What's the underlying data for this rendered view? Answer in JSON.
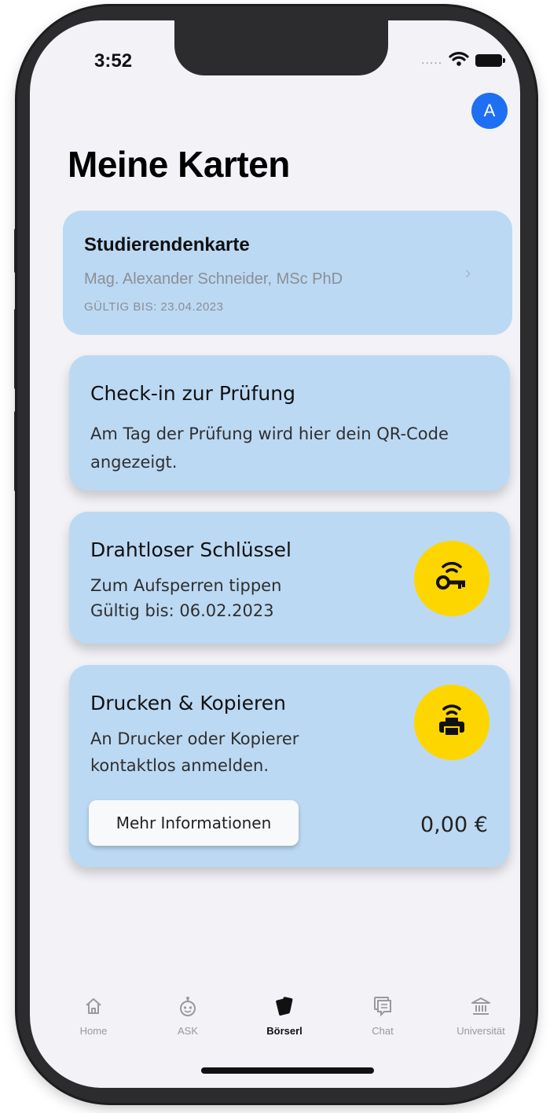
{
  "status_bar": {
    "time": "3:52",
    "signal_dots": "....."
  },
  "header": {
    "avatar_initial": "A",
    "title": "Meine Karten"
  },
  "cards": {
    "student": {
      "title": "Studierendenkarte",
      "name": "Mag. Alexander Schneider, MSc PhD",
      "valid": "GÜLTIG BIS: 23.04.2023",
      "chevron": "›"
    },
    "checkin": {
      "title": "Check-in zur Prüfung",
      "line1": "Am Tag der Prüfung wird hier dein QR-Code",
      "line2": "angezeigt."
    },
    "key": {
      "title": "Drahtloser Schlüssel",
      "line1": "Zum Aufsperren tippen",
      "line2": "Gültig bis: 06.02.2023",
      "icon": "wireless-key-icon"
    },
    "print": {
      "title": "Drucken & Kopieren",
      "line1": "An Drucker oder Kopierer",
      "line2": "kontaktlos anmelden.",
      "button": "Mehr Informationen",
      "balance": "0,00 €",
      "icon": "wireless-printer-icon"
    }
  },
  "tabbar": {
    "items": [
      {
        "label": "Home",
        "icon": "home-icon"
      },
      {
        "label": "ASK",
        "icon": "robot-icon"
      },
      {
        "label": "Börserl",
        "icon": "wallet-cards-icon"
      },
      {
        "label": "Chat",
        "icon": "chat-icon"
      },
      {
        "label": "Universität",
        "icon": "university-icon"
      }
    ],
    "active": "Börserl"
  },
  "colors": {
    "card_bg": "#bcd9f3",
    "accent_yellow": "#fdd600",
    "avatar_blue": "#1f6ff2",
    "screen_bg": "#f2f2f7"
  }
}
